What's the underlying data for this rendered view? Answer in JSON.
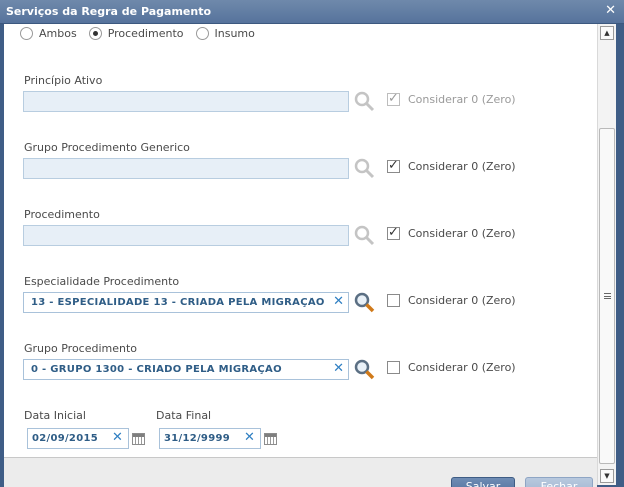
{
  "dialog": {
    "title": "Serviços da Regra de Pagamento",
    "close_icon": "close-icon"
  },
  "type_options": [
    {
      "label": "Ambos",
      "selected": false
    },
    {
      "label": "Procedimento",
      "selected": true
    },
    {
      "label": "Insumo",
      "selected": false
    }
  ],
  "fields": {
    "principio_ativo": {
      "label": "Princípio Ativo",
      "value": "",
      "considerar_label": "Considerar 0 (Zero)",
      "considerar_checked": true,
      "considerar_enabled": false
    },
    "grupo_procedimento_generico": {
      "label": "Grupo Procedimento Generico",
      "value": "",
      "considerar_label": "Considerar 0 (Zero)",
      "considerar_checked": true,
      "considerar_enabled": true
    },
    "procedimento": {
      "label": "Procedimento",
      "value": "",
      "considerar_label": "Considerar 0 (Zero)",
      "considerar_checked": true,
      "considerar_enabled": true
    },
    "especialidade_procedimento": {
      "label": "Especialidade Procedimento",
      "value": "13 - ESPECIALIDADE 13 - CRIADA PELA MIGRAÇÃO",
      "considerar_label": "Considerar 0 (Zero)",
      "considerar_checked": false,
      "considerar_enabled": true
    },
    "grupo_procedimento": {
      "label": "Grupo Procedimento",
      "value": "0 - GRUPO 1300 - CRIADO PELA MIGRAÇÃO",
      "considerar_label": "Considerar 0 (Zero)",
      "considerar_checked": false,
      "considerar_enabled": true
    }
  },
  "dates": {
    "inicial": {
      "label": "Data Inicial",
      "value": "02/09/2015"
    },
    "final": {
      "label": "Data Final",
      "value": "31/12/9999"
    }
  },
  "footer": {
    "save_label": "Salvar",
    "close_label": "Fechar"
  },
  "icons": {
    "search": "search-icon",
    "clear": "clear-icon",
    "calendar": "calendar-icon"
  },
  "colors": {
    "titlebar": "#56739c",
    "field_text": "#2f5d86",
    "clear_icon": "#2f7fc2"
  }
}
